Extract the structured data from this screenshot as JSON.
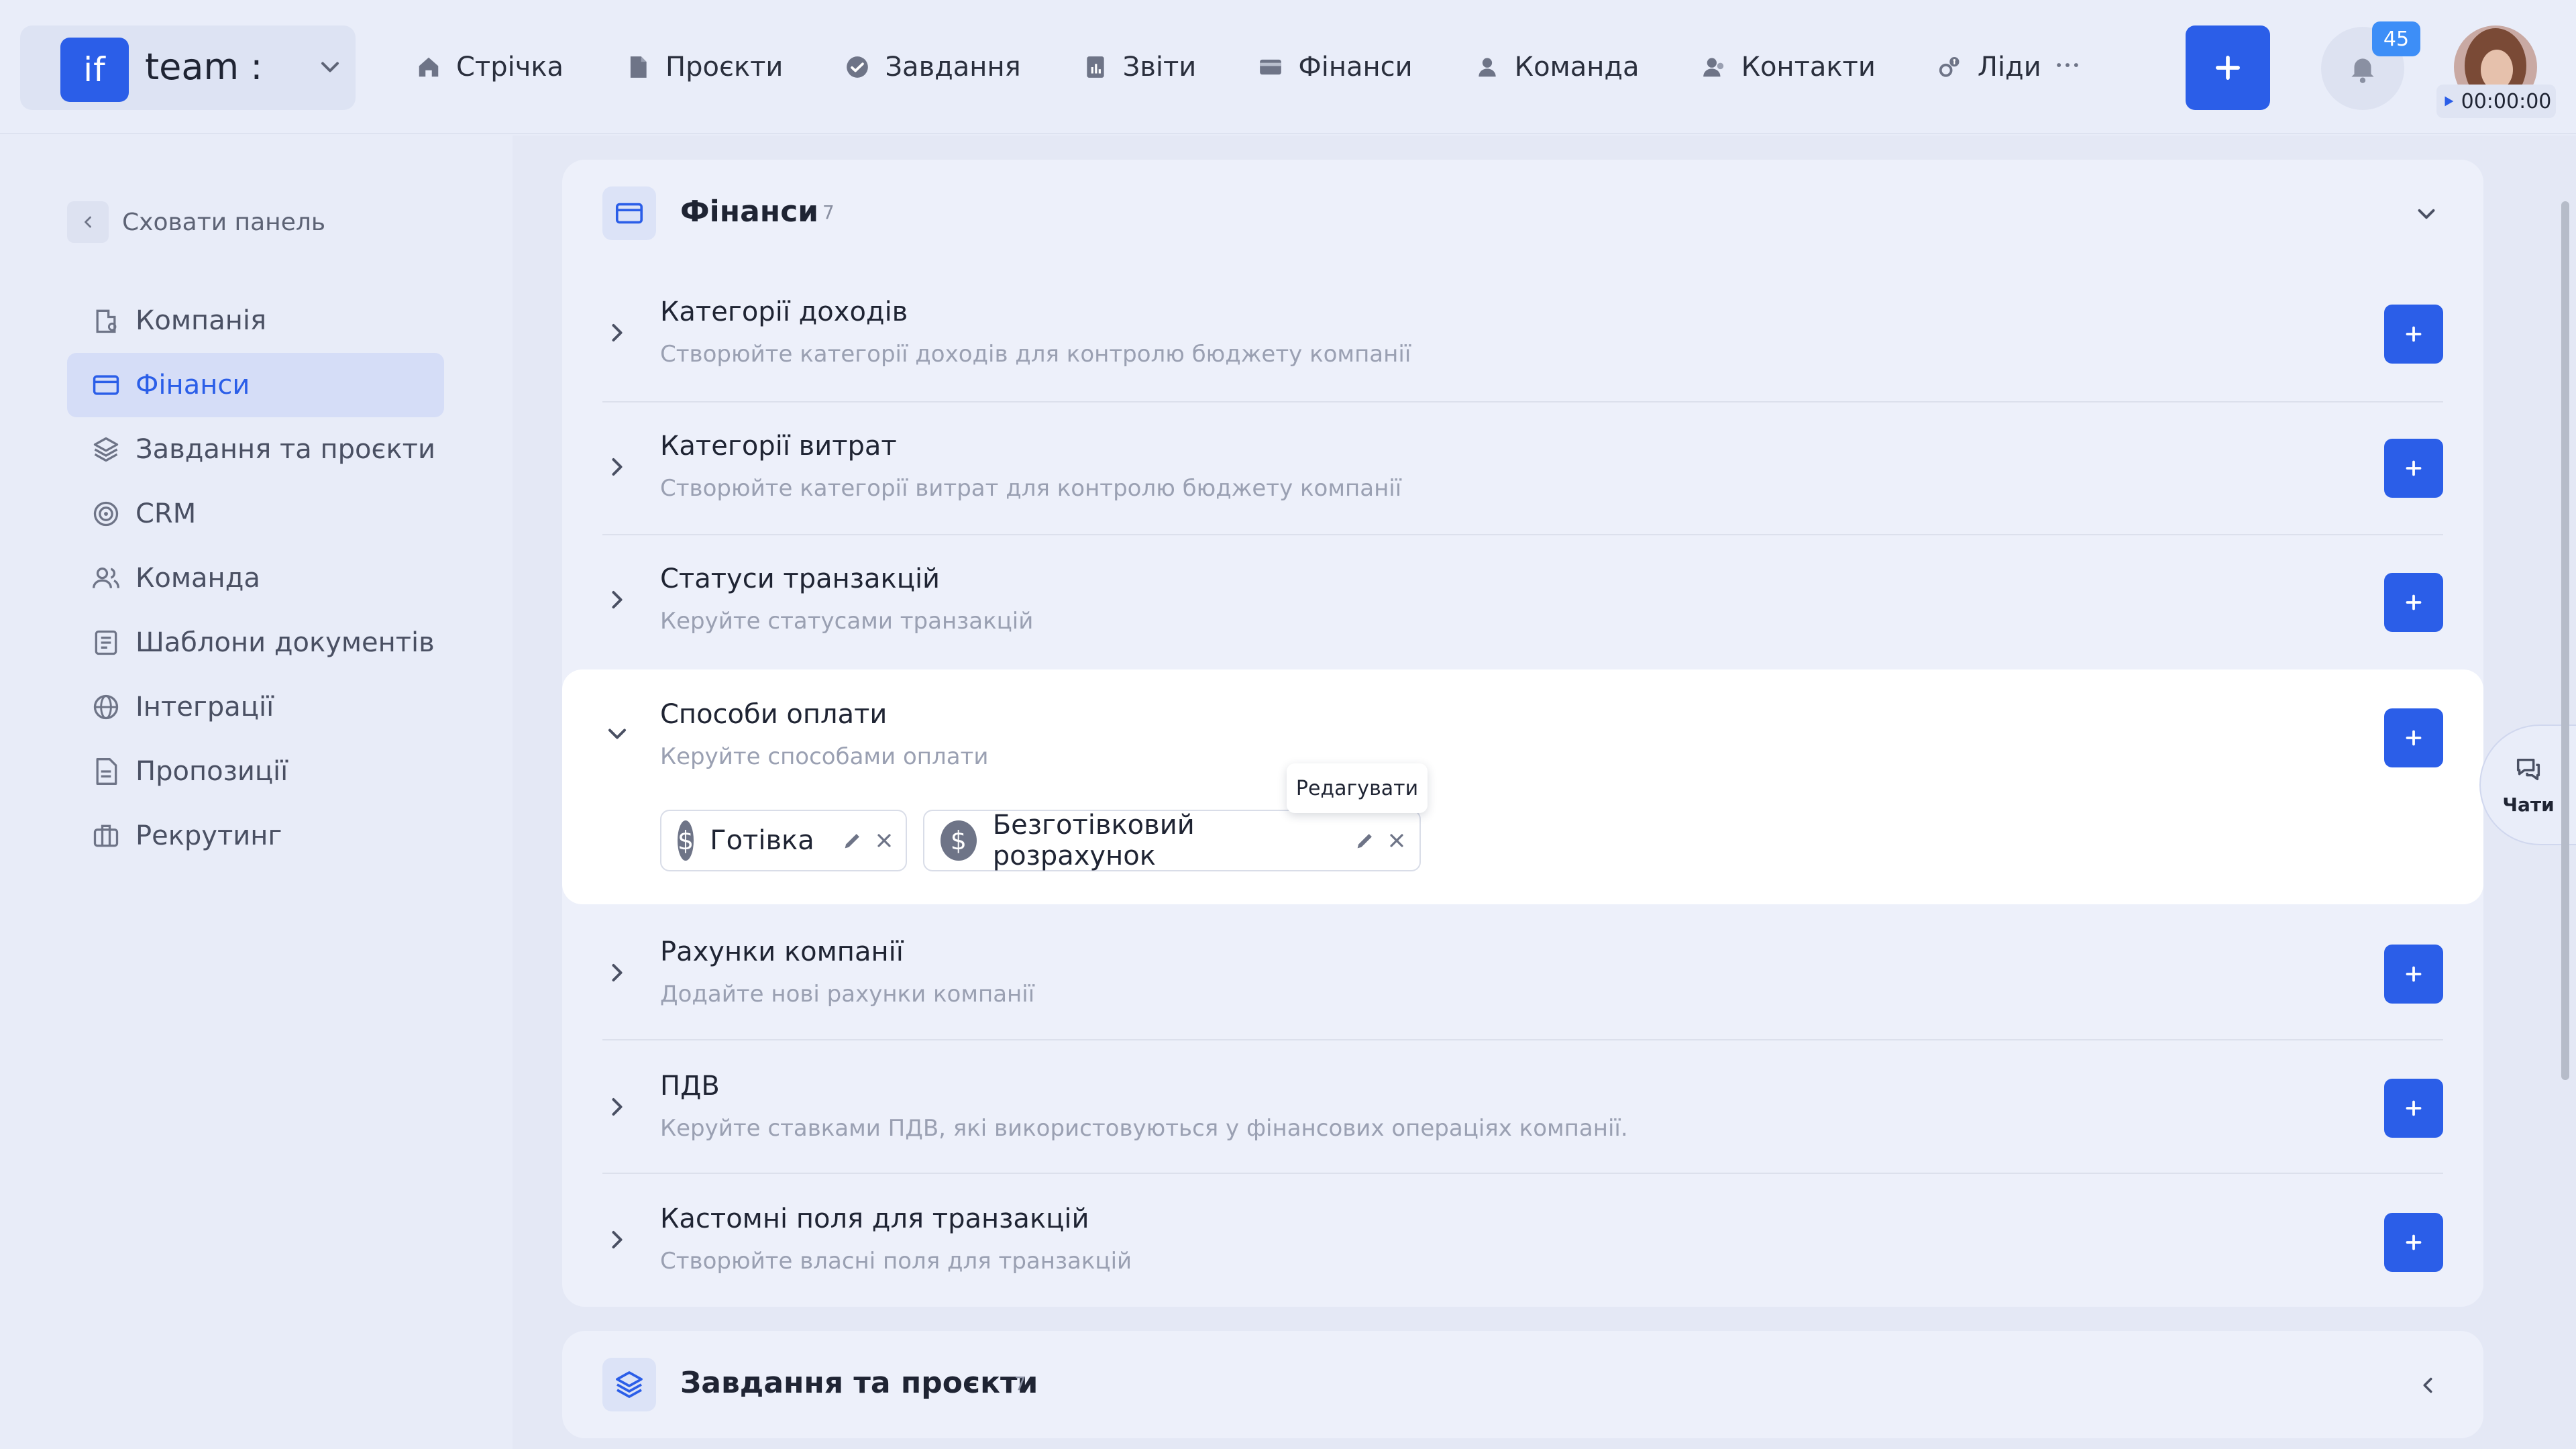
{
  "brand": {
    "logo": "if",
    "name": "team :"
  },
  "nav": {
    "items": [
      {
        "label": "Стрічка",
        "icon": "home-icon"
      },
      {
        "label": "Проєкти",
        "icon": "document-icon"
      },
      {
        "label": "Завдання",
        "icon": "check-circle-icon"
      },
      {
        "label": "Звіти",
        "icon": "report-icon"
      },
      {
        "label": "Фінанси",
        "icon": "wallet-icon"
      },
      {
        "label": "Команда",
        "icon": "user-icon"
      },
      {
        "label": "Контакти",
        "icon": "contacts-icon"
      },
      {
        "label": "Ліди",
        "icon": "leads-icon"
      }
    ],
    "more": "···"
  },
  "header": {
    "notifications_count": "45",
    "timer": "00:00:00"
  },
  "sidebar": {
    "hide_label": "Сховати панель",
    "items": [
      {
        "label": "Компанія",
        "icon": "company-icon",
        "active": false
      },
      {
        "label": "Фінанси",
        "icon": "card-icon",
        "active": true
      },
      {
        "label": "Завдання та проєкти",
        "icon": "layers-icon",
        "active": false
      },
      {
        "label": "CRM",
        "icon": "target-icon",
        "active": false
      },
      {
        "label": "Команда",
        "icon": "team-icon",
        "active": false
      },
      {
        "label": "Шаблони документів",
        "icon": "template-icon",
        "active": false
      },
      {
        "label": "Інтеграції",
        "icon": "globe-icon",
        "active": false
      },
      {
        "label": "Пропозиції",
        "icon": "proposal-icon",
        "active": false
      },
      {
        "label": "Рекрутинг",
        "icon": "briefcase-icon",
        "active": false
      }
    ]
  },
  "finance": {
    "title": "Фінанси",
    "count": "7",
    "sections": [
      {
        "title": "Категорії доходів",
        "desc": "Створюйте категорії доходів для контролю бюджету компанії"
      },
      {
        "title": "Категорії витрат",
        "desc": "Створюйте категорії витрат для контролю бюджету компанії"
      },
      {
        "title": "Статуси транзакцій",
        "desc": "Керуйте статусами транзакцій"
      },
      {
        "title": "Способи оплати",
        "desc": "Керуйте способами оплати"
      },
      {
        "title": "Рахунки компанії",
        "desc": "Додайте нові рахунки компанії"
      },
      {
        "title": "ПДВ",
        "desc": "Керуйте ставками ПДВ, які використовуються у фінансових операціях компанії."
      },
      {
        "title": "Кастомні поля для транзакцій",
        "desc": "Створюйте власні поля для транзакцій"
      }
    ],
    "payment_methods": [
      {
        "label": "Готівка",
        "icon": "dollar-coin-icon"
      },
      {
        "label": "Безготівковий розрахунок",
        "icon": "dollar-coin-icon"
      }
    ],
    "tooltip": "Редагувати"
  },
  "tasks_card": {
    "title": "Завдання та проєкти",
    "count": "7"
  },
  "chats": {
    "label": "Чати"
  },
  "colors": {
    "accent": "#2b5ee8",
    "badge": "#3d8ef7",
    "background": "#e8ecf8"
  }
}
